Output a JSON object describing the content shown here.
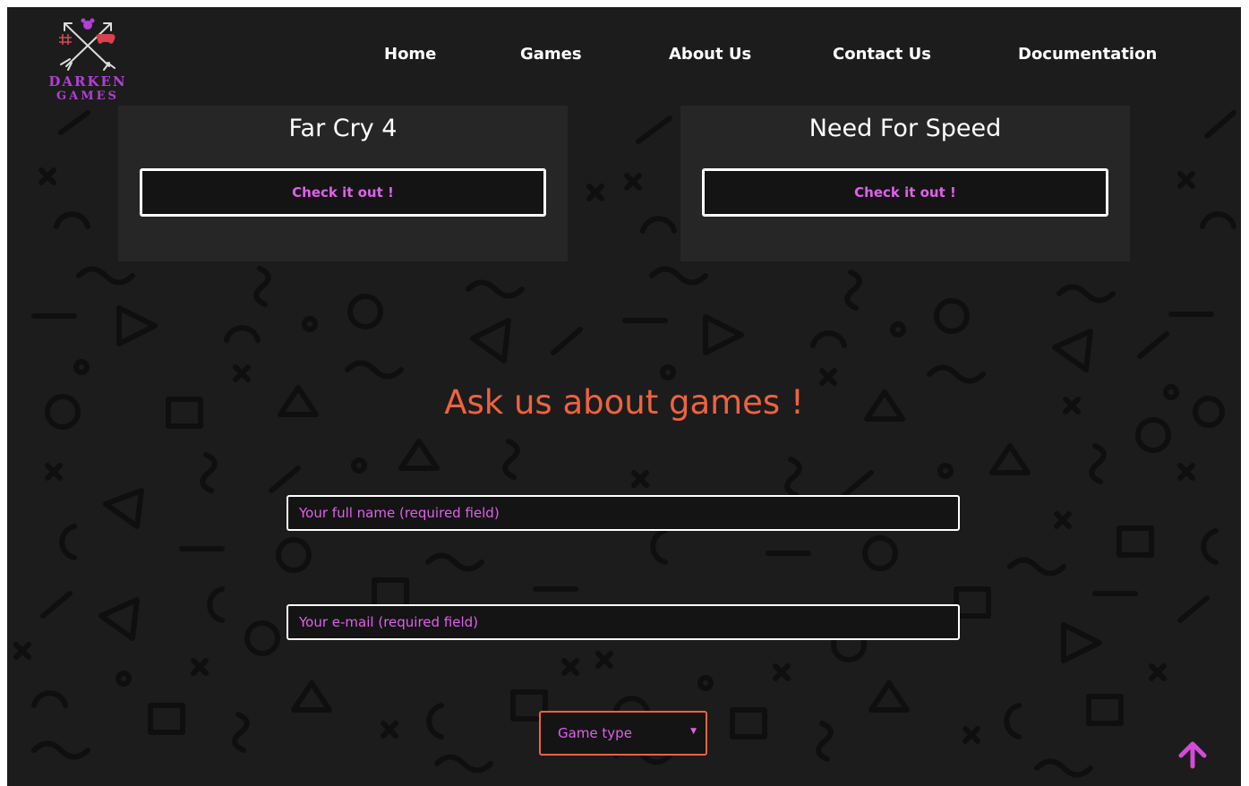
{
  "brand": {
    "line1": "DARKEN",
    "line2": "GAMES",
    "icon": "crossed-arrows-gamepad-logo",
    "color": "#b43fd6"
  },
  "nav": {
    "home": "Home",
    "games": "Games",
    "about": "About Us",
    "contact": "Contact Us",
    "docs": "Documentation"
  },
  "cards": [
    {
      "title": "Far Cry 4",
      "button": "Check it out !"
    },
    {
      "title": "Need For Speed",
      "button": "Check it out !"
    }
  ],
  "contact_form": {
    "title": "Ask us about games !",
    "name_placeholder": "Your full name (required field)",
    "email_placeholder": "Your e-mail (required field)",
    "game_type": "Game type"
  },
  "icons": {
    "back_to_top": "arrow-up-icon",
    "select_caret": "caret-down-icon"
  },
  "colors": {
    "background": "#1c1c1c",
    "card": "#262626",
    "accent_pink": "#e060ec",
    "accent_orange": "#f0623f",
    "text": "#ffffff"
  }
}
